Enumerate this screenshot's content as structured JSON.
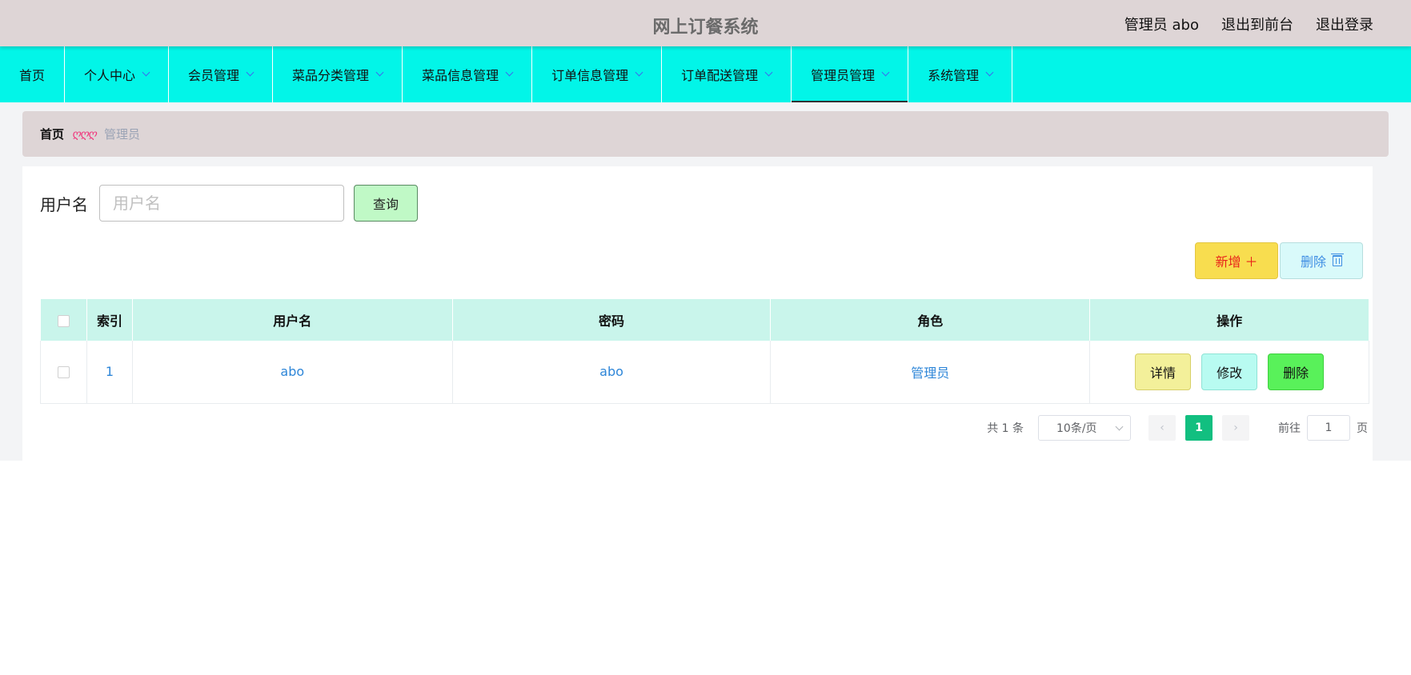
{
  "header": {
    "title": "网上订餐系统",
    "user_label": "管理员 abo",
    "front_link": "退出到前台",
    "logout_link": "退出登录"
  },
  "nav": {
    "items": [
      {
        "label": "首页",
        "dropdown": false
      },
      {
        "label": "个人中心",
        "dropdown": true
      },
      {
        "label": "会员管理",
        "dropdown": true
      },
      {
        "label": "菜品分类管理",
        "dropdown": true
      },
      {
        "label": "菜品信息管理",
        "dropdown": true
      },
      {
        "label": "订单信息管理",
        "dropdown": true
      },
      {
        "label": "订单配送管理",
        "dropdown": true
      },
      {
        "label": "管理员管理",
        "dropdown": true,
        "active": true
      },
      {
        "label": "系统管理",
        "dropdown": true
      }
    ]
  },
  "breadcrumb": {
    "home": "首页",
    "separator": "ღღღ",
    "current": "管理员"
  },
  "search": {
    "label": "用户名",
    "placeholder": "用户名",
    "value": "",
    "button": "查询"
  },
  "actions": {
    "add": "新增 ＋",
    "delete": "删除"
  },
  "table": {
    "headers": [
      "索引",
      "用户名",
      "密码",
      "角色",
      "操作"
    ],
    "rows": [
      {
        "index": "1",
        "username": "abo",
        "password": "abo",
        "role": "管理员"
      }
    ],
    "row_buttons": {
      "detail": "详情",
      "edit": "修改",
      "delete": "删除"
    }
  },
  "pagination": {
    "total": "共 1 条",
    "page_size": "10条/页",
    "prev": "‹",
    "current_page": "1",
    "next": "›",
    "goto_label": "前往",
    "goto_value": "1",
    "page_suffix": "页"
  },
  "colors": {
    "topbar": "#ded5d6",
    "navbar": "#02f5e8",
    "table_header": "#c9f5eb",
    "page_active": "#12bf80"
  }
}
